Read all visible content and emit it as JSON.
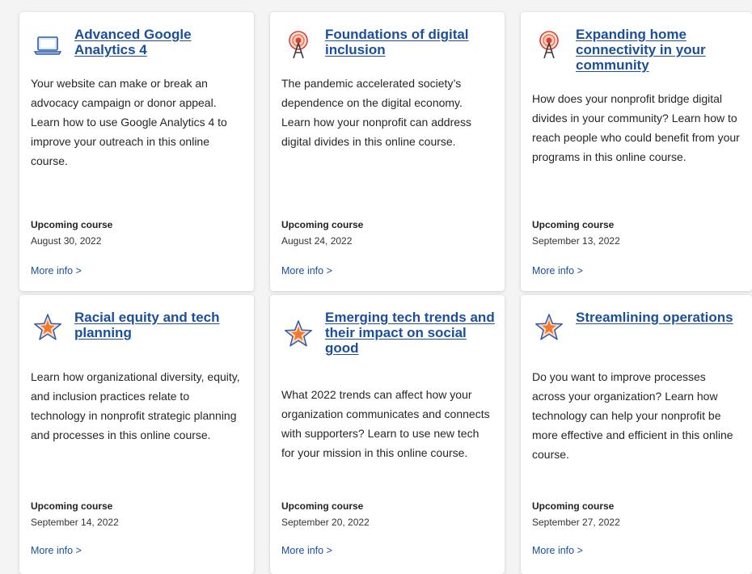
{
  "courses": [
    {
      "icon": "laptop-icon",
      "title": "Advanced Google Analytics 4",
      "description": "Your website can make or break an advocacy campaign or donor appeal. Learn how to use Google Analytics 4 to improve your outreach in this online course.",
      "status": "Upcoming course",
      "date": "August 30, 2022",
      "link": "More info >"
    },
    {
      "icon": "broadcast-tower-icon",
      "title": "Foundations of digital inclusion",
      "description": "The pandemic accelerated society’s dependence on the digital economy. Learn how your nonprofit can address digital divides in this online course.",
      "status": "Upcoming course",
      "date": "August 24, 2022",
      "link": "More info >"
    },
    {
      "icon": "broadcast-tower-icon",
      "title": "Expanding home connectivity in your community",
      "description": "How does your nonprofit bridge digital divides in your community? Learn how to reach people who could benefit from your programs in this online course.",
      "status": "Upcoming course",
      "date": "September 13, 2022",
      "link": "More info >"
    },
    {
      "icon": "star-icon",
      "title": "Racial equity and tech planning",
      "description": "Learn how organizational diversity, equity, and inclusion practices relate to technology in nonprofit strategic planning and processes in this online course.",
      "status": "Upcoming course",
      "date": "September 14, 2022",
      "link": "More info >"
    },
    {
      "icon": "star-icon",
      "title": "Emerging tech trends and their impact on social good",
      "description": "What 2022 trends can affect how your organization communicates and connects with supporters? Learn to use new tech for your mission in this online course.",
      "status": "Upcoming course",
      "date": "September 20, 2022",
      "link": "More info >"
    },
    {
      "icon": "star-icon",
      "title": "Streamlining operations",
      "description": "Do you want to improve processes across your organization? Learn how technology can help your nonprofit be more effective and efficient in this online course.",
      "status": "Upcoming course",
      "date": "September 27, 2022",
      "link": "More info >"
    }
  ],
  "colors": {
    "link": "#1b4f9c",
    "accent_orange": "#f07a2a",
    "accent_red": "#e2393b"
  }
}
